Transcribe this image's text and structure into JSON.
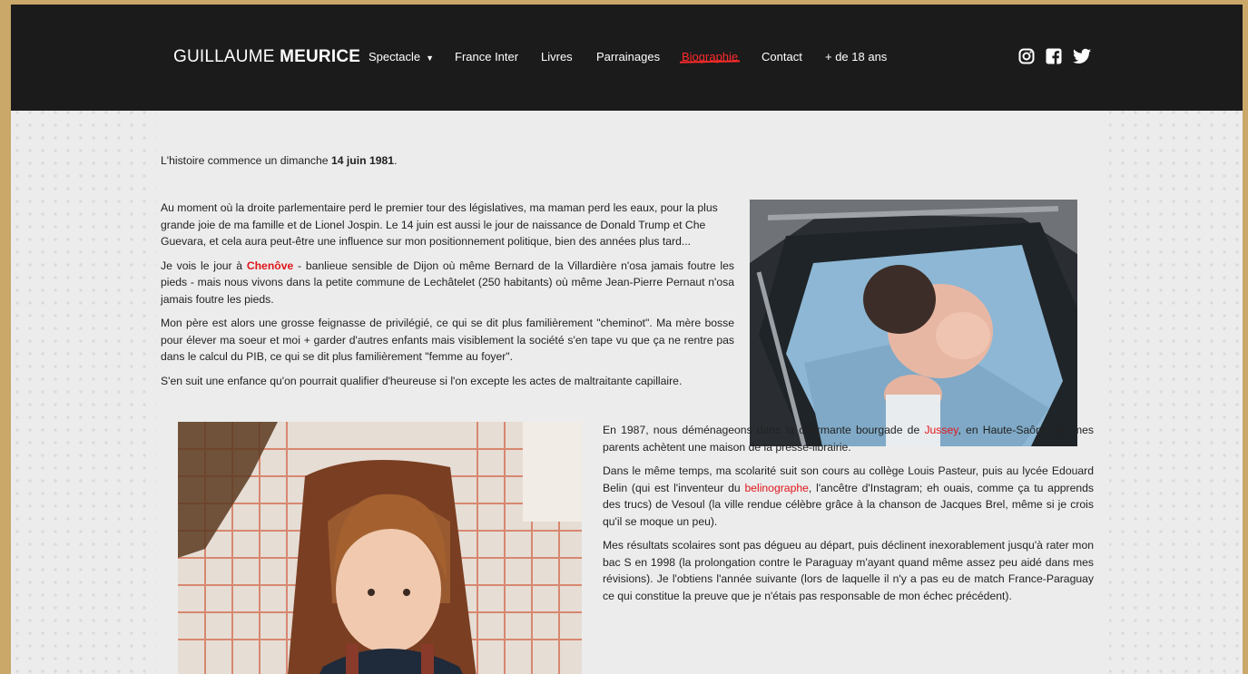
{
  "header": {
    "brand_first": "GUILLAUME ",
    "brand_last": "MEURICE",
    "nav": [
      {
        "label": "Spectacle"
      },
      {
        "label": "France Inter"
      },
      {
        "label": "Livres"
      },
      {
        "label": "Parrainages"
      },
      {
        "label": "Biographie",
        "active": true
      },
      {
        "label": "Contact"
      },
      {
        "label": "+ de 18 ans"
      }
    ],
    "social_icons": [
      "instagram-icon",
      "facebook-icon",
      "twitter-icon"
    ]
  },
  "content": {
    "intro_prefix": "L'histoire commence un dimanche ",
    "intro_date": "14 juin 1981",
    "intro_suffix": ".",
    "p1": "Au moment où la droite parlementaire perd le premier tour des législatives, ma maman perd les eaux, pour la plus grande joie de ma famille et de Lionel Jospin. Le 14 juin est aussi le jour de naissance de Donald Trump et Che Guevara, et cela aura peut-être une influence sur mon positionnement politique, bien des années plus tard...",
    "p2_prefix": "Je vois le jour à ",
    "p2_link": "Chenôve",
    "p2_suffix": " - banlieue sensible de Dijon où même Bernard de la Villardière n'osa jamais foutre les pieds - mais nous vivons dans la petite commune de Lechâtelet (250 habitants) où même Jean-Pierre Pernaut n'osa jamais foutre les pieds.",
    "p3": "Mon père est alors une grosse feignasse de privilégié, ce qui se dit plus familièrement \"cheminot\". Ma mère bosse pour élever ma soeur et moi + garder d'autres enfants mais visiblement la société s'en tape vu que ça ne rentre pas dans le calcul du PIB, ce qui se dit plus familièrement \"femme au foyer\".",
    "p4": "S'en suit une enfance qu'on pourrait qualifier d'heureuse si l'on excepte les actes de maltraitante capillaire.",
    "p5_prefix": "En 1987, nous déménageons dans la charmante bourgade de ",
    "p5_link": "Jussey",
    "p5_suffix": ", en Haute-Saône, où mes parents achètent une maison de la presse-librairie.",
    "p6_prefix": "Dans le même temps, ma scolarité suit son cours au collège Louis Pasteur, puis au lycée Edouard Belin (qui est l'inventeur du ",
    "p6_link": "belinographe",
    "p6_suffix": ", l'ancêtre d'Instagram; eh ouais, comme ça tu apprends des trucs) de Vesoul (la ville rendue célèbre grâce à la chanson de Jacques Brel, même si je crois qu'il se moque un peu).",
    "p7": "Mes résultats scolaires sont pas dégueu au départ, puis déclinent inexorablement jusqu'à rater mon bac S en 1998 (la prolongation contre le Paraguay m'ayant quand même assez peu aidé dans mes révisions). Je l'obtiens l'année suivante (lors de laquelle il n'y a pas eu de match France-Paraguay ce qui constitue la preuve que je n'étais pas responsable de mon échec précédent)."
  },
  "colors": {
    "accent": "#e0161b",
    "navbar": "#1b1b1b",
    "background": "#ececec",
    "frame": "#c9a86a"
  }
}
